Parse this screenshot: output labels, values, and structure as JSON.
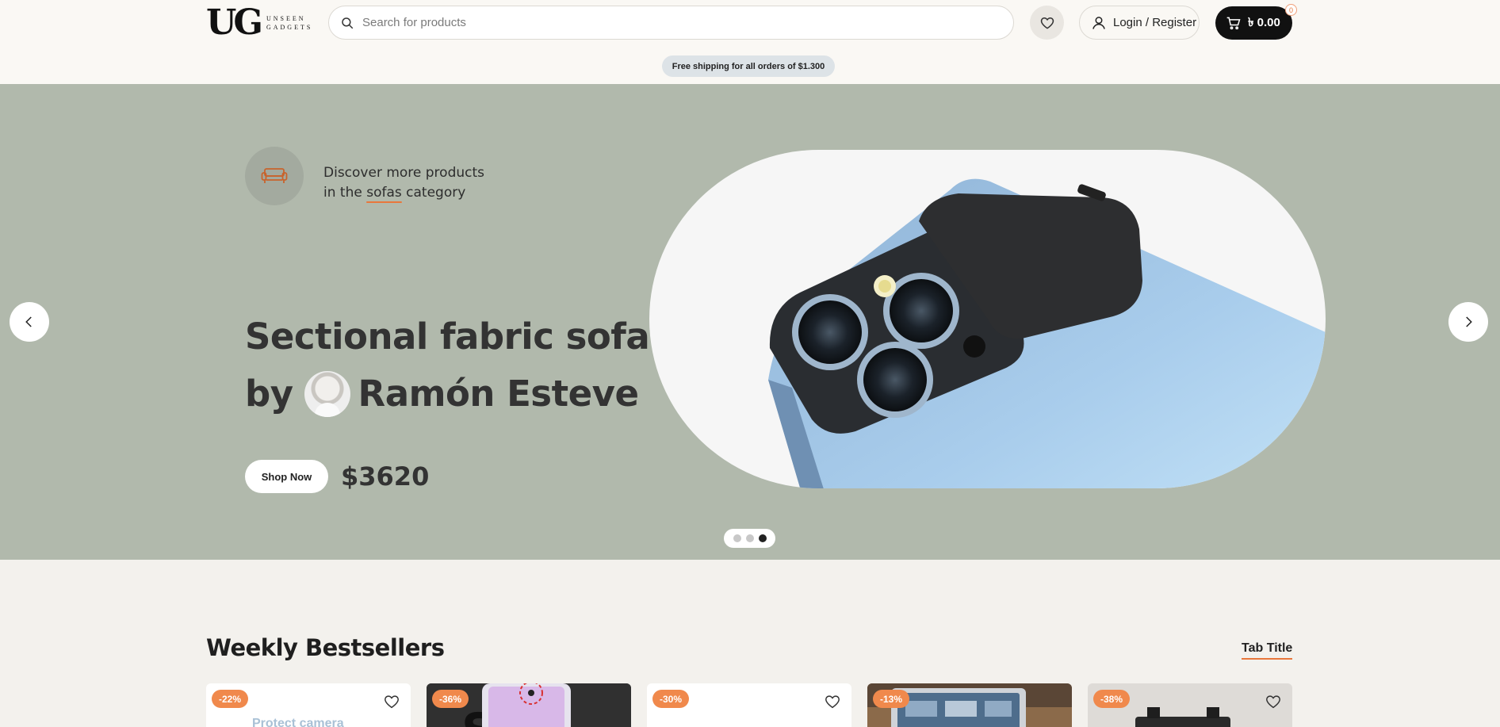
{
  "header": {
    "logo": {
      "mark": "UG",
      "line1": "UNSEEN",
      "line2": "GADGETS"
    },
    "search": {
      "placeholder": "Search for products",
      "value": ""
    },
    "login_label": "Login / Register",
    "cart": {
      "amount": "৳ 0.00",
      "count": "0"
    },
    "shipping_notice": "Free shipping for all orders of $1.300"
  },
  "hero": {
    "category_text_pre": "Discover more products",
    "category_text_mid": "in the ",
    "category_highlight": "sofas",
    "category_text_post": " category",
    "title_line1": "Sectional fabric sofa",
    "title_by": "by",
    "title_author": "Ramón Esteve",
    "shop_button": "Shop Now",
    "price": "$3620",
    "active_slide": 3,
    "total_slides": 3
  },
  "bestsellers": {
    "title": "Weekly Bestsellers",
    "tab_title": "Tab Title",
    "cards": [
      {
        "discount": "-22%",
        "text": "Protect camera"
      },
      {
        "discount": "-36%",
        "text": ""
      },
      {
        "discount": "-30%",
        "text": ""
      },
      {
        "discount": "-13%",
        "text": ""
      },
      {
        "discount": "-38%",
        "text": ""
      }
    ]
  },
  "colors": {
    "accent": "#f0894c",
    "hero_bg": "#b1b9ac",
    "page_bg": "#f3f1ed",
    "cart_bg": "#111111"
  },
  "icons": [
    "search-icon",
    "heart-icon",
    "user-icon",
    "cart-icon",
    "sofa-icon",
    "chevron-left-icon",
    "chevron-right-icon"
  ]
}
